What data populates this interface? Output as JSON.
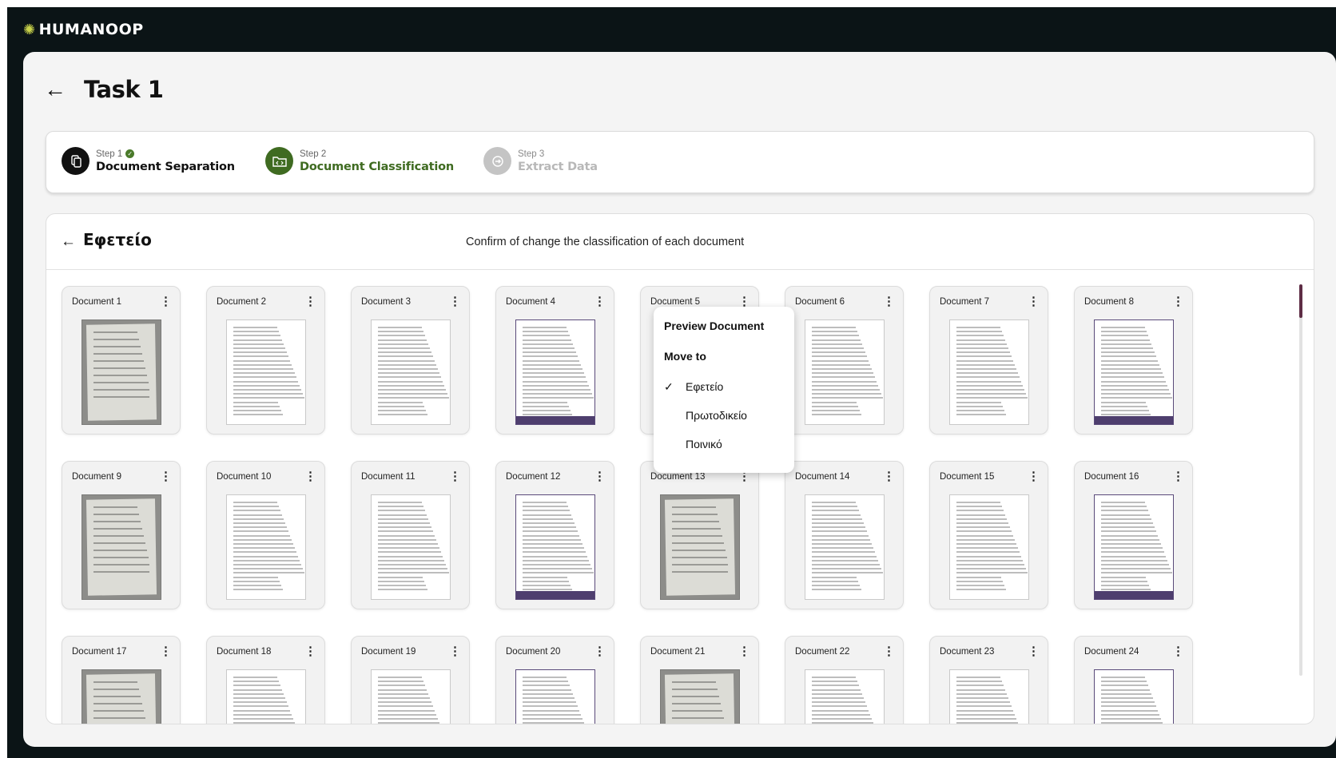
{
  "brand": {
    "logo_text": "HUMANOOP",
    "logo_icon": "gear-icon"
  },
  "page": {
    "title": "Task 1"
  },
  "steps": [
    {
      "step": "Step 1",
      "label": "Document Separation",
      "status": "done",
      "icon": "documents-icon",
      "color": "#111111"
    },
    {
      "step": "Step 2",
      "label": "Document Classification",
      "status": "active",
      "icon": "folder-code-icon",
      "color": "#3f6b21"
    },
    {
      "step": "Step 3",
      "label": "Extract Data",
      "status": "pending",
      "icon": "export-icon",
      "color": "#c4c4c4"
    }
  ],
  "category": {
    "name": "Εφετείο",
    "instruction": "Confirm of change the classification of each document"
  },
  "documents": [
    {
      "name": "Document 1",
      "thumb": "photo"
    },
    {
      "name": "Document 2",
      "thumb": "text"
    },
    {
      "name": "Document 3",
      "thumb": "text"
    },
    {
      "name": "Document 4",
      "thumb": "purple"
    },
    {
      "name": "Document 5",
      "thumb": "photo"
    },
    {
      "name": "Document 6",
      "thumb": "text"
    },
    {
      "name": "Document 7",
      "thumb": "text"
    },
    {
      "name": "Document 8",
      "thumb": "purple"
    },
    {
      "name": "Document 9",
      "thumb": "photo"
    },
    {
      "name": "Document 10",
      "thumb": "text"
    },
    {
      "name": "Document 11",
      "thumb": "text"
    },
    {
      "name": "Document 12",
      "thumb": "purple"
    },
    {
      "name": "Document 13",
      "thumb": "photo"
    },
    {
      "name": "Document 14",
      "thumb": "text"
    },
    {
      "name": "Document 15",
      "thumb": "text"
    },
    {
      "name": "Document 16",
      "thumb": "purple"
    },
    {
      "name": "Document 17",
      "thumb": "photo"
    },
    {
      "name": "Document 18",
      "thumb": "text"
    },
    {
      "name": "Document 19",
      "thumb": "text"
    },
    {
      "name": "Document 20",
      "thumb": "purple"
    },
    {
      "name": "Document 21",
      "thumb": "photo"
    },
    {
      "name": "Document 22",
      "thumb": "text"
    },
    {
      "name": "Document 23",
      "thumb": "text"
    },
    {
      "name": "Document 24",
      "thumb": "purple"
    }
  ],
  "context_menu": {
    "preview": "Preview Document",
    "move_to": "Move to",
    "options": [
      {
        "label": "Εφετείο",
        "selected": true
      },
      {
        "label": "Πρωτοδικείο",
        "selected": false
      },
      {
        "label": "Ποινικό",
        "selected": false
      }
    ]
  },
  "colors": {
    "frame": "#0b1416",
    "accent_green": "#3f6b21",
    "scroll_thumb": "#5e2d45"
  }
}
